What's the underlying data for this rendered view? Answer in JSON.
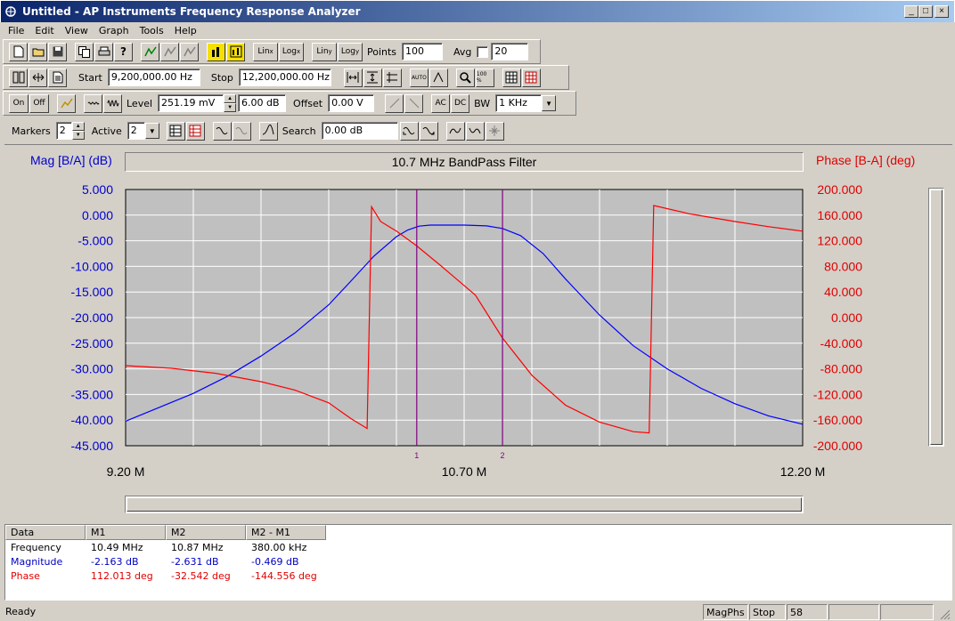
{
  "window": {
    "title": "Untitled - AP Instruments Frequency Response Analyzer",
    "buttons": [
      "_",
      "□",
      "×"
    ]
  },
  "menu": [
    "File",
    "Edit",
    "View",
    "Graph",
    "Tools",
    "Help"
  ],
  "toolbar1": {
    "points_label": "Points",
    "points_value": "100",
    "avg_label": "Avg",
    "avg_checked": false,
    "avg_value": "20",
    "lin_x": "Lin",
    "log_x": "Log",
    "lin_y": "Lin",
    "log_y": "Log",
    "x_sup": "x",
    "y_sup": "y"
  },
  "toolbar2": {
    "start_label": "Start",
    "start_value": "9,200,000.00 Hz",
    "stop_label": "Stop",
    "stop_value": "12,200,000.00 Hz",
    "auto_label": "AUTO",
    "percent_label": "100 %"
  },
  "toolbar3": {
    "on_label": "On",
    "off_label": "Off",
    "level_label": "Level",
    "level_value": "251.19 mV",
    "level_db": "6.00 dB",
    "offset_label": "Offset",
    "offset_value": "0.00 V",
    "ac_label": "AC",
    "dc_label": "DC",
    "bw_label": "BW",
    "bw_value": "1 KHz"
  },
  "toolbar4": {
    "markers_label": "Markers",
    "markers_value": "2",
    "active_label": "Active",
    "active_value": "2",
    "search_label": "Search",
    "search_value": "0.00 dB"
  },
  "colors": {
    "magnitude": "#0000ff",
    "phase": "#ff0000",
    "marker": "#800080",
    "plot_bg": "#c0c0c0",
    "grid": "#ffffff"
  },
  "chart_data": {
    "type": "line",
    "title": "10.7 MHz BandPass Filter",
    "ylabel_left": "Mag [B/A] (dB)",
    "ylabel_right": "Phase [B-A] (deg)",
    "xlim": [
      9.2,
      12.2
    ],
    "ylim_left": [
      -45,
      5
    ],
    "ylim_right": [
      -200,
      200
    ],
    "x_ticks": [
      "9.20 M",
      "10.70 M",
      "12.20 M"
    ],
    "y_ticks_left": [
      "5.000",
      "0.000",
      "-5.000",
      "-10.000",
      "-15.000",
      "-20.000",
      "-25.000",
      "-30.000",
      "-35.000",
      "-40.000",
      "-45.000"
    ],
    "y_ticks_right": [
      "200.000",
      "160.000",
      "120.000",
      "80.000",
      "40.000",
      "0.000",
      "-40.000",
      "-80.000",
      "-120.000",
      "-160.000",
      "-200.000"
    ],
    "grid": true,
    "markers": [
      {
        "label": "1",
        "x": 10.49
      },
      {
        "label": "2",
        "x": 10.87
      }
    ],
    "series": [
      {
        "name": "Magnitude",
        "axis": "left",
        "x": [
          9.2,
          9.35,
          9.5,
          9.65,
          9.8,
          9.95,
          10.1,
          10.2,
          10.3,
          10.4,
          10.45,
          10.5,
          10.55,
          10.6,
          10.7,
          10.8,
          10.87,
          10.95,
          11.05,
          11.15,
          11.3,
          11.45,
          11.6,
          11.75,
          11.9,
          12.05,
          12.2
        ],
        "values": [
          -40.2,
          -37.5,
          -34.8,
          -31.5,
          -27.5,
          -23.0,
          -17.5,
          -12.8,
          -8.0,
          -4.2,
          -2.9,
          -2.15,
          -1.95,
          -1.95,
          -1.95,
          -2.1,
          -2.6,
          -4.0,
          -7.5,
          -12.5,
          -19.5,
          -25.5,
          -30.0,
          -33.8,
          -36.8,
          -39.2,
          -40.8
        ]
      },
      {
        "name": "Phase",
        "axis": "right",
        "x": [
          9.2,
          9.4,
          9.6,
          9.8,
          9.95,
          10.1,
          10.2,
          10.27,
          10.29,
          10.33,
          10.4,
          10.49,
          10.6,
          10.75,
          10.87,
          11.0,
          11.15,
          11.3,
          11.45,
          11.52,
          11.54,
          11.7,
          11.9,
          12.05,
          12.2
        ],
        "values": [
          -75,
          -79,
          -87,
          -100,
          -113,
          -133,
          -158,
          -173,
          173,
          150,
          135,
          112,
          80,
          35,
          -32,
          -90,
          -137,
          -163,
          -178,
          -180,
          175,
          162,
          150,
          142,
          135
        ]
      }
    ]
  },
  "data_table": {
    "headers": [
      "Data",
      "M1",
      "M2",
      "M2 - M1"
    ],
    "rows": [
      {
        "name": "Frequency",
        "color": "#000000",
        "m1": "10.49 MHz",
        "m2": "10.87 MHz",
        "diff": "380.00 kHz"
      },
      {
        "name": "Magnitude",
        "color": "#0000c0",
        "m1": "-2.163 dB",
        "m2": "-2.631 dB",
        "diff": "-0.469 dB"
      },
      {
        "name": "Phase",
        "color": "#e00000",
        "m1": "112.013 deg",
        "m2": "-32.542 deg",
        "diff": "-144.556 deg"
      }
    ]
  },
  "status": {
    "text": "Ready",
    "mode": "MagPhs",
    "state": "Stop",
    "count": "58"
  }
}
